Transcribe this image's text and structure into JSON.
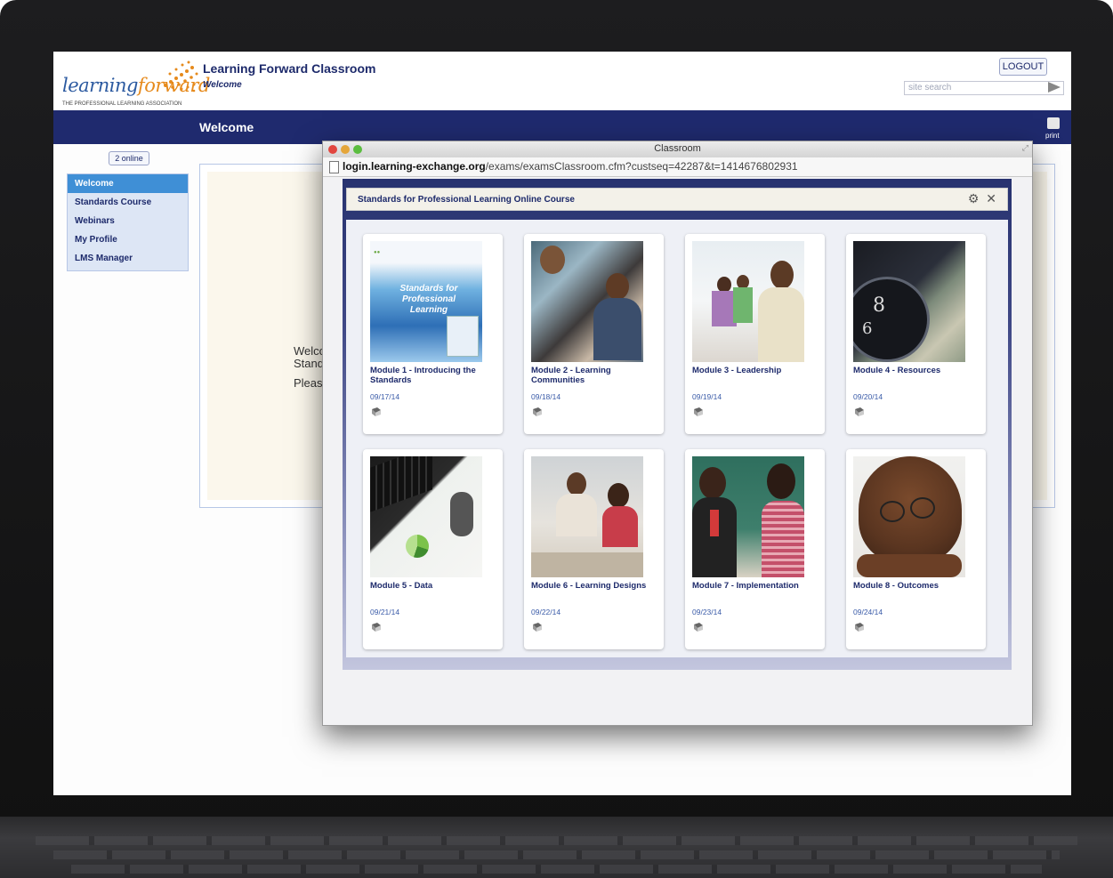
{
  "site": {
    "logo_word_1": "learning",
    "logo_word_2": "forward",
    "logo_tagline": "THE PROFESSIONAL LEARNING ASSOCIATION",
    "title": "Learning Forward Classroom",
    "subtitle": "Welcome",
    "logout_label": "LOGOUT",
    "search_placeholder": "site search",
    "nav_title": "Welcome",
    "print_label": "print",
    "online_count": "2 online"
  },
  "sidebar": {
    "items": [
      {
        "label": "Welcome",
        "active": true
      },
      {
        "label": "Standards Course",
        "active": false
      },
      {
        "label": "Webinars",
        "active": false
      },
      {
        "label": "My Profile",
        "active": false
      },
      {
        "label": "LMS Manager",
        "active": false
      }
    ]
  },
  "content": {
    "line1": "Welco",
    "line2": "Stand",
    "line3": "Pleas"
  },
  "popup": {
    "window_title": "Classroom",
    "url_domain": "login.learning-exchange.org",
    "url_path": "/exams/examsClassroom.cfm?custseq=42287&t=1414676802931",
    "course_title": "Standards for Professional Learning Online Course",
    "cover_title": "Standards for Professional Learning",
    "modules": [
      {
        "name": "Module 1 - Introducing the Standards",
        "date": "09/17/14",
        "thumb": "book-cover"
      },
      {
        "name": "Module 2 - Learning Communities",
        "date": "09/18/14",
        "thumb": "group-discussion-photo"
      },
      {
        "name": "Module 3 - Leadership",
        "date": "09/19/14",
        "thumb": "leader-meeting-photo"
      },
      {
        "name": "Module 4 - Resources",
        "date": "09/20/14",
        "thumb": "clock-and-money-photo"
      },
      {
        "name": "Module 5 - Data",
        "date": "09/21/14",
        "thumb": "keyboard-and-charts-photo"
      },
      {
        "name": "Module 6 - Learning Designs",
        "date": "09/22/14",
        "thumb": "teacher-student-photo"
      },
      {
        "name": "Module 7 - Implementation",
        "date": "09/23/14",
        "thumb": "two-women-photo"
      },
      {
        "name": "Module 8 - Outcomes",
        "date": "09/24/14",
        "thumb": "child-with-glasses-photo"
      }
    ]
  },
  "colors": {
    "brand_navy": "#1f2a6e",
    "brand_orange": "#e68a1c",
    "active_blue": "#3f8fd6"
  }
}
